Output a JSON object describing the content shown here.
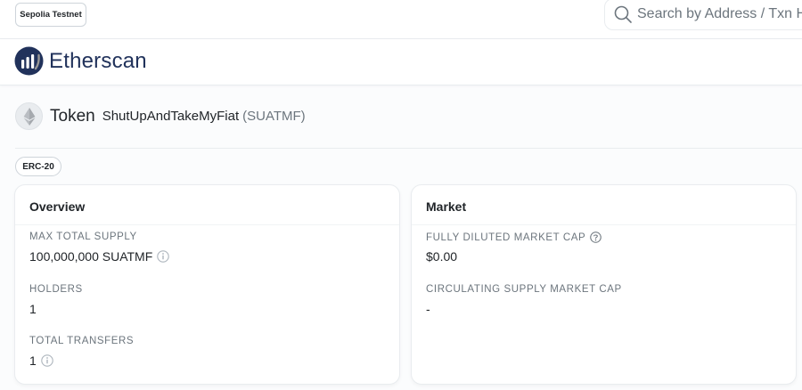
{
  "topbar": {
    "network": "Sepolia Testnet",
    "search": {
      "placeholder": "Search by Address / Txn Hash / Block / Token / Domain Name"
    }
  },
  "brand": {
    "name": "Etherscan"
  },
  "token": {
    "kind": "Token",
    "name": "ShutUpAndTakeMyFiat",
    "symbol": "(SUATMF)",
    "standard": "ERC-20"
  },
  "overview": {
    "title": "Overview",
    "max_supply_label": "MAX TOTAL SUPPLY",
    "max_supply_value": "100,000,000 SUATMF",
    "holders_label": "HOLDERS",
    "holders_value": "1",
    "transfers_label": "TOTAL TRANSFERS",
    "transfers_value": "1"
  },
  "market": {
    "title": "Market",
    "fdmc_label": "FULLY DILUTED MARKET CAP",
    "fdmc_value": "$0.00",
    "csmc_label": "CIRCULATING SUPPLY MARKET CAP",
    "csmc_value": "-"
  },
  "colors": {
    "brand": "#21325b",
    "muted": "#6c757d",
    "border": "#e9ecef"
  }
}
